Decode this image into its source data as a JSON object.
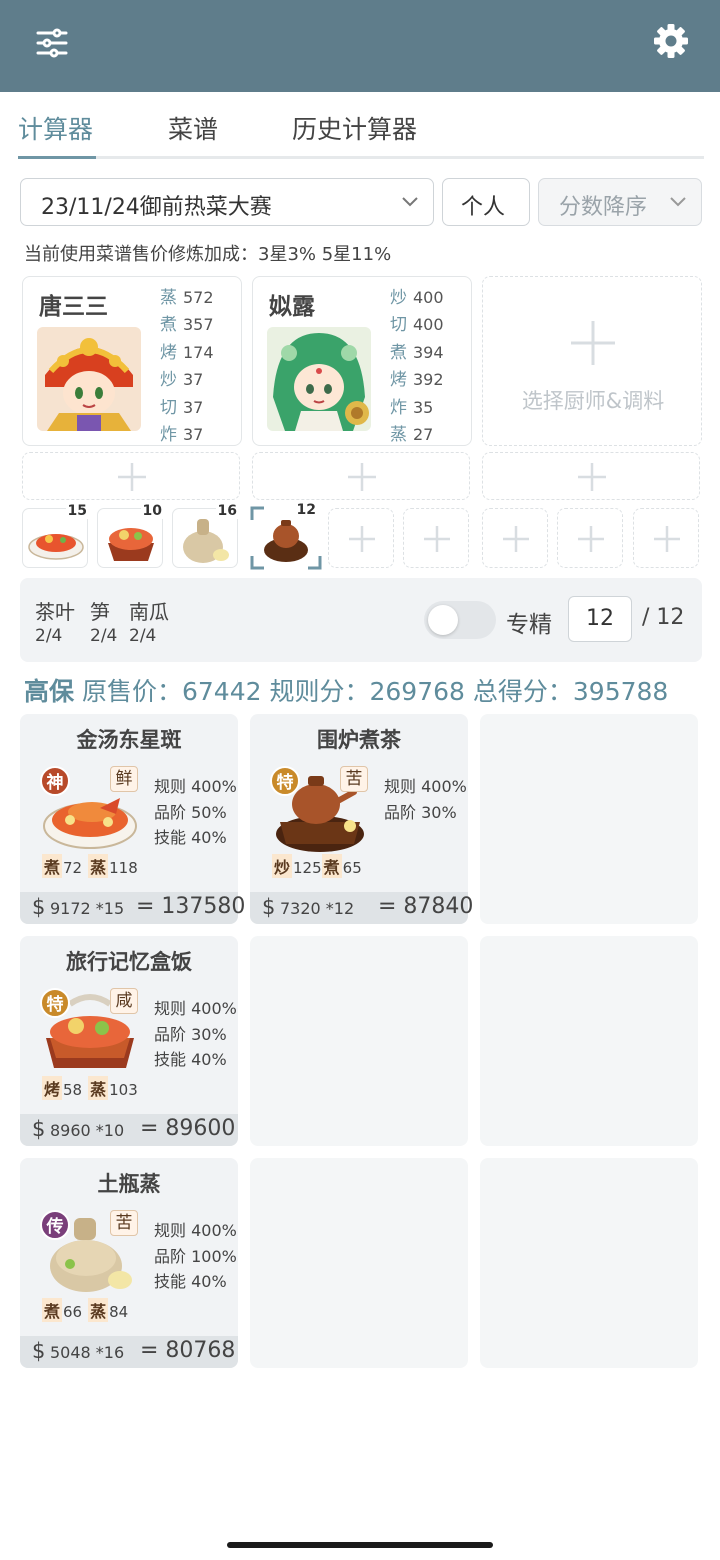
{
  "header": {
    "filter_icon": "sliders-icon",
    "settings_icon": "gear-icon",
    "bar_color": "#5f7d8b"
  },
  "tabs": [
    {
      "label": "计算器",
      "active": true
    },
    {
      "label": "菜谱",
      "active": false
    },
    {
      "label": "历史计算器",
      "active": false
    }
  ],
  "controls": {
    "rule_select": "23/11/24御前热菜大赛",
    "mode_button": "个人",
    "sort_select": "分数降序"
  },
  "note": "当前使用菜谱售价修炼加成：3星3% 5星11%",
  "chefs": [
    {
      "name": "唐三三",
      "skills": [
        {
          "k": "蒸",
          "v": "572"
        },
        {
          "k": "煮",
          "v": "357"
        },
        {
          "k": "烤",
          "v": "174"
        },
        {
          "k": "炒",
          "v": "37"
        },
        {
          "k": "切",
          "v": "37"
        },
        {
          "k": "炸",
          "v": "37"
        }
      ]
    },
    {
      "name": "姒露",
      "skills": [
        {
          "k": "炒",
          "v": "400"
        },
        {
          "k": "切",
          "v": "400"
        },
        {
          "k": "煮",
          "v": "394"
        },
        {
          "k": "烤",
          "v": "392"
        },
        {
          "k": "炸",
          "v": "35"
        },
        {
          "k": "蒸",
          "v": "27"
        }
      ]
    }
  ],
  "add_chef_label": "选择厨师&调料",
  "equip_counts": [
    "15",
    "10",
    "16",
    "12"
  ],
  "materials": {
    "names": [
      "茶叶",
      "笋",
      "南瓜"
    ],
    "counts": [
      "2/4",
      "2/4",
      "2/4"
    ]
  },
  "specialize": {
    "label": "专精",
    "value": "12",
    "max": "/ 12",
    "enabled": false
  },
  "summary": {
    "level": "高保",
    "price_label": "原售价：",
    "price": "67442",
    "rule_label": "规则分：",
    "rule": "269768",
    "total_label": "总得分：",
    "total": "395788"
  },
  "dishes": [
    {
      "name": "金汤东星斑",
      "grade": "神",
      "grade_color": "#b84a2a",
      "flavor": "鲜",
      "rules": [
        "规则 400%",
        "品阶 50%",
        "技能 40%"
      ],
      "reqs": [
        {
          "k": "煮",
          "v": "72"
        },
        {
          "k": "蒸",
          "v": "118"
        }
      ],
      "price": "9172 *15",
      "total": "= 137580"
    },
    {
      "name": "围炉煮茶",
      "grade": "特",
      "grade_color": "#c98a2a",
      "flavor": "苦",
      "rules": [
        "规则 400%",
        "品阶 30%"
      ],
      "reqs": [
        {
          "k": "炒",
          "v": "125"
        },
        {
          "k": "煮",
          "v": "65"
        }
      ],
      "price": "7320 *12",
      "total": "= 87840"
    },
    {
      "name": "旅行记忆盒饭",
      "grade": "特",
      "grade_color": "#c98a2a",
      "flavor": "咸",
      "rules": [
        "规则 400%",
        "品阶 30%",
        "技能 40%"
      ],
      "reqs": [
        {
          "k": "烤",
          "v": "58"
        },
        {
          "k": "蒸",
          "v": "103"
        }
      ],
      "price": "8960 *10",
      "total": "= 89600"
    },
    {
      "name": "土瓶蒸",
      "grade": "传",
      "grade_color": "#7a3f7a",
      "flavor": "苦",
      "rules": [
        "规则 400%",
        "品阶 100%",
        "技能 40%"
      ],
      "reqs": [
        {
          "k": "煮",
          "v": "66"
        },
        {
          "k": "蒸",
          "v": "84"
        }
      ],
      "price": "5048 *16",
      "total": "= 80768"
    }
  ],
  "currency_symbol": "$"
}
